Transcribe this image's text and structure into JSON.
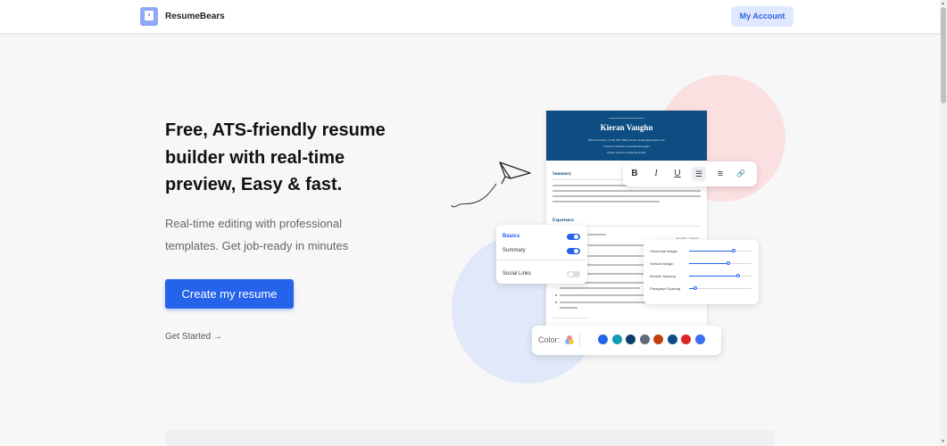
{
  "header": {
    "brand": "ResumeBears",
    "account_label": "My Account"
  },
  "hero": {
    "title": "Free, ATS-friendly resume builder with real-time preview, Easy & fast.",
    "subtitle": "Real-time editing with professional templates. Get job-ready in minutes",
    "cta_label": "Create my resume",
    "secondary_label": "Get Started →"
  },
  "resume": {
    "name": "Kieran Vaughn",
    "contact_line_1": "Web Developer | (123) 456-7890 | kieran.vaughn@example.com",
    "contact_line_2": "LinkedIn: linkedin.com/in/kieranvaughn",
    "contact_line_3": "Github: github.com/kieranvaughn",
    "summary_heading": "Summary",
    "experience_heading": "Experience",
    "job_date": "Jan 2022 - Present"
  },
  "toolbar": {
    "bold": "B",
    "italic": "I",
    "underline": "U",
    "bullet_list": "☰",
    "numbered_list": "≡",
    "link": "🔗"
  },
  "sections_panel": {
    "basics_label": "Basics",
    "summary_label": "Summary",
    "social_links_label": "Social Links",
    "basics_on": true,
    "summary_on": true,
    "social_links_on": false
  },
  "sliders_panel": {
    "items": [
      {
        "label": "Horizontal Margin",
        "value": 0.72
      },
      {
        "label": "Vertical Margin",
        "value": 0.63
      },
      {
        "label": "Module Spacing",
        "value": 0.78
      },
      {
        "label": "Paragraph Spacing",
        "value": 0.1
      }
    ]
  },
  "color_panel": {
    "label": "Color:",
    "icon": "palette-icon",
    "swatches": [
      "#2563eb",
      "#0e9fb5",
      "#0e3d6b",
      "#5f6b7a",
      "#c2410c",
      "#0e4d82",
      "#dc2626",
      "#3b6ff0"
    ]
  },
  "colors": {
    "accent": "#2563eb",
    "resume_header": "#0e4d82"
  }
}
